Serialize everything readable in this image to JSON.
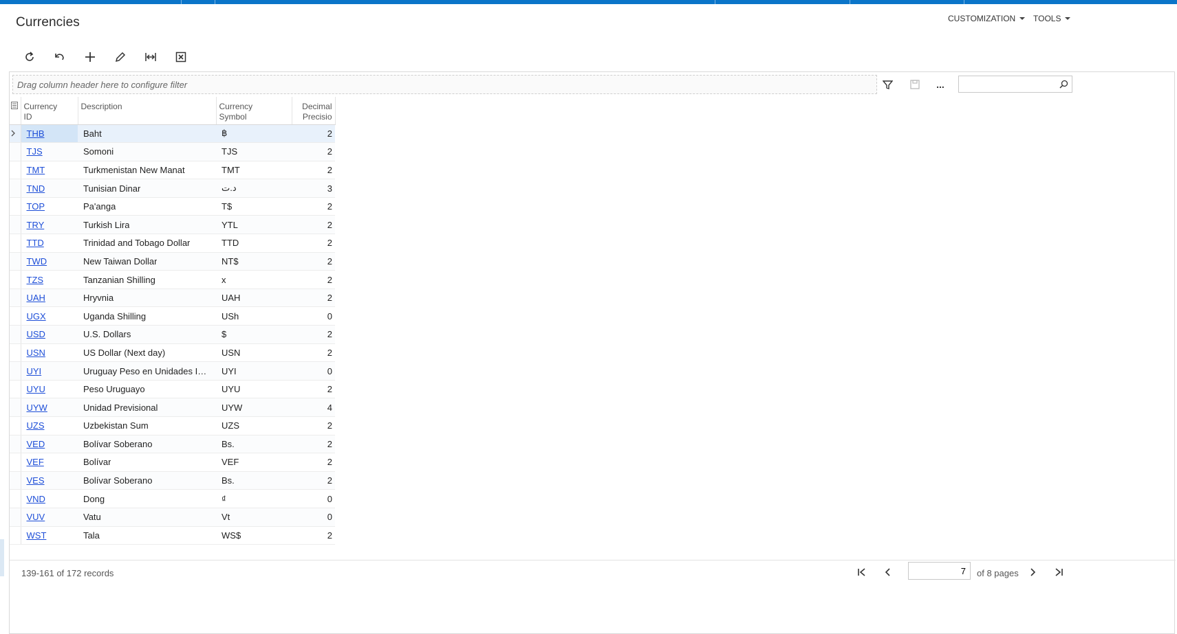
{
  "page": {
    "title": "Currencies"
  },
  "menu": {
    "customization": "CUSTOMIZATION",
    "tools": "TOOLS"
  },
  "toolbar": [
    {
      "name": "refresh-button",
      "icon": "refresh-icon"
    },
    {
      "name": "undo-button",
      "icon": "undo-icon"
    },
    {
      "name": "add-button",
      "icon": "plus-icon"
    },
    {
      "name": "edit-button",
      "icon": "pencil-icon"
    },
    {
      "name": "fit-columns-button",
      "icon": "fit-width-icon"
    },
    {
      "name": "export-excel-button",
      "icon": "excel-icon"
    }
  ],
  "grid": {
    "filter_placeholder": "Drag column header here to configure filter",
    "more_label": "...",
    "search": {
      "value": "",
      "placeholder": ""
    },
    "columns": {
      "currency_id": [
        "Currency",
        "ID"
      ],
      "description": "Description",
      "symbol": [
        "Currency",
        "Symbol"
      ],
      "precision": [
        "Decimal",
        "Precisio"
      ]
    },
    "rows": [
      {
        "id": "THB",
        "description": "Baht",
        "symbol": "฿",
        "precision": "2"
      },
      {
        "id": "TJS",
        "description": "Somoni",
        "symbol": "TJS",
        "precision": "2"
      },
      {
        "id": "TMT",
        "description": "Turkmenistan New Manat",
        "symbol": "TMT",
        "precision": "2"
      },
      {
        "id": "TND",
        "description": "Tunisian Dinar",
        "symbol": "د.ت",
        "precision": "3"
      },
      {
        "id": "TOP",
        "description": "Pa'anga",
        "symbol": "T$",
        "precision": "2"
      },
      {
        "id": "TRY",
        "description": "Turkish Lira",
        "symbol": "YTL",
        "precision": "2"
      },
      {
        "id": "TTD",
        "description": "Trinidad and Tobago Dollar",
        "symbol": "TTD",
        "precision": "2"
      },
      {
        "id": "TWD",
        "description": "New Taiwan Dollar",
        "symbol": "NT$",
        "precision": "2"
      },
      {
        "id": "TZS",
        "description": "Tanzanian Shilling",
        "symbol": "x",
        "precision": "2"
      },
      {
        "id": "UAH",
        "description": "Hryvnia",
        "symbol": "UAH",
        "precision": "2"
      },
      {
        "id": "UGX",
        "description": "Uganda Shilling",
        "symbol": "USh",
        "precision": "0"
      },
      {
        "id": "USD",
        "description": "U.S. Dollars",
        "symbol": "$",
        "precision": "2"
      },
      {
        "id": "USN",
        "description": "US Dollar (Next day)",
        "symbol": "USN",
        "precision": "2"
      },
      {
        "id": "UYI",
        "description": "Uruguay Peso en Unidades Inde...",
        "symbol": "UYI",
        "precision": "0"
      },
      {
        "id": "UYU",
        "description": "Peso Uruguayo",
        "symbol": "UYU",
        "precision": "2"
      },
      {
        "id": "UYW",
        "description": "Unidad Previsional",
        "symbol": "UYW",
        "precision": "4"
      },
      {
        "id": "UZS",
        "description": "Uzbekistan Sum",
        "symbol": "UZS",
        "precision": "2"
      },
      {
        "id": "VED",
        "description": "Bolívar Soberano",
        "symbol": "Bs.",
        "precision": "2"
      },
      {
        "id": "VEF",
        "description": "Bolívar",
        "symbol": "VEF",
        "precision": "2"
      },
      {
        "id": "VES",
        "description": "Bolívar Soberano",
        "symbol": "Bs.",
        "precision": "2"
      },
      {
        "id": "VND",
        "description": "Dong",
        "symbol": "₫",
        "precision": "0"
      },
      {
        "id": "VUV",
        "description": "Vatu",
        "symbol": "Vt",
        "precision": "0"
      },
      {
        "id": "WST",
        "description": "Tala",
        "symbol": "WS$",
        "precision": "2"
      }
    ]
  },
  "pager": {
    "records_text": "139-161 of 172 records",
    "current_page": "7",
    "of_pages_text": "of 8 pages"
  },
  "colors": {
    "accent": "#0b75c9",
    "link": "#1d4ed8",
    "selected_row": "#e8f1fb"
  }
}
